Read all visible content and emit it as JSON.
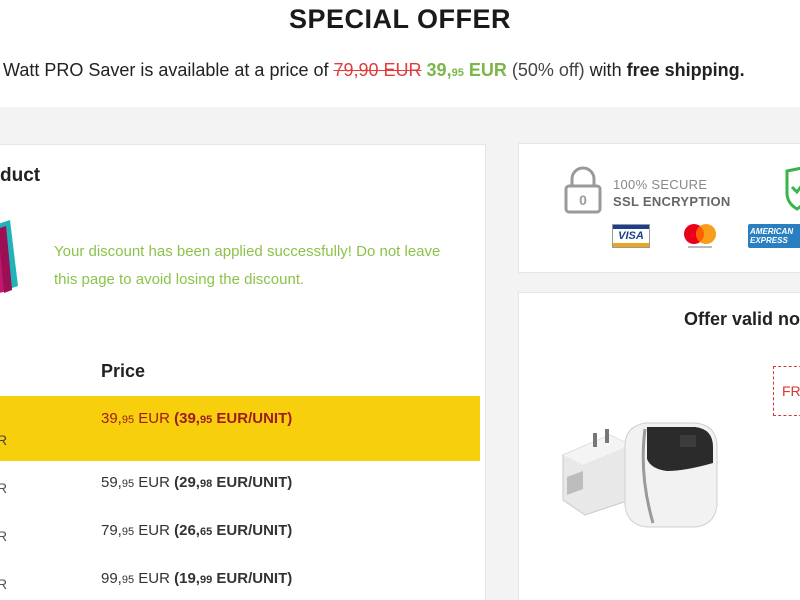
{
  "header": {
    "title": "SPECIAL OFFER",
    "offer_prefix": "Watt PRO Saver is available at a price of ",
    "old_price": "79,90 EUR",
    "new_price_main": "39,",
    "new_price_cents": "95",
    "new_price_currency": " EUR",
    "discount": "(50% off)",
    "with_text": " with ",
    "shipping": "free shipping."
  },
  "product": {
    "heading_fragment": "duct",
    "discount_message": "Your discount has been applied successfully! Do not leave this page to avoid losing the discount.",
    "price_header": "Price",
    "rows": [
      {
        "qty_fragment": "R",
        "price_main": "39,",
        "price_cents": "95",
        "currency": " EUR ",
        "unit_main": "(39,",
        "unit_cents": "95",
        "unit_suffix": " EUR/UNIT)"
      },
      {
        "qty_fragment": "R",
        "price_main": "59,",
        "price_cents": "95",
        "currency": " EUR ",
        "unit_main": "(29,",
        "unit_cents": "98",
        "unit_suffix": " EUR/UNIT)"
      },
      {
        "qty_fragment": "R",
        "price_main": "79,",
        "price_cents": "95",
        "currency": " EUR ",
        "unit_main": "(26,",
        "unit_cents": "65",
        "unit_suffix": " EUR/UNIT)"
      },
      {
        "qty_fragment": "R",
        "price_main": "99,",
        "price_cents": "95",
        "currency": " EUR ",
        "unit_main": "(19,",
        "unit_cents": "99",
        "unit_suffix": " EUR/UNIT)"
      }
    ],
    "selected_index": 0
  },
  "security": {
    "line1": "100% SECURE",
    "line2": "SSL ENCRYPTION",
    "visa": "VISA",
    "amex_line1": "AMERICAN",
    "amex_line2": "EXPRESS"
  },
  "offer_box": {
    "title": "Offer valid no",
    "badge_fragment": "FR"
  },
  "colors": {
    "accent_green": "#7ab648",
    "old_price_red": "#e23b3b",
    "selected_row": "#f7cf0d"
  }
}
